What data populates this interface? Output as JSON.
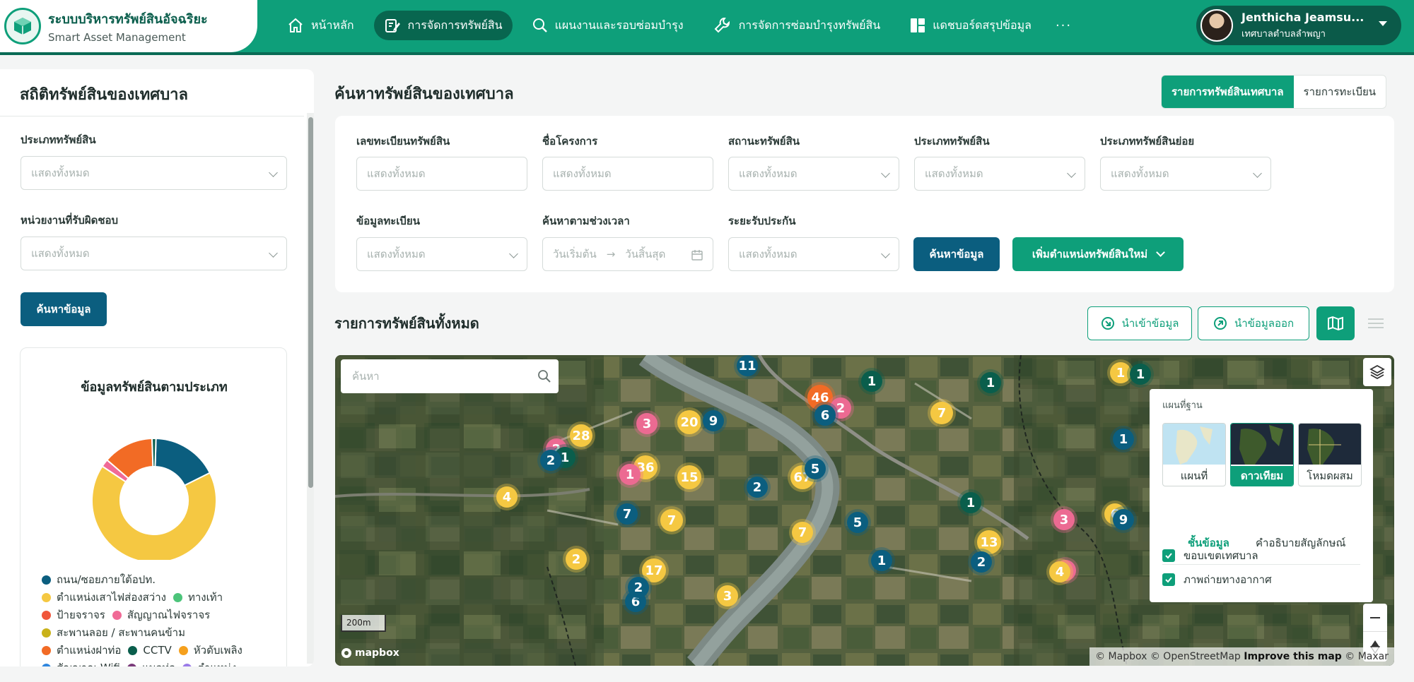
{
  "header": {
    "app_title": "ระบบบริหารทรัพย์สินอัจฉริยะ",
    "app_subtitle": "Smart Asset Management",
    "nav": [
      {
        "label": "หน้าหลัก"
      },
      {
        "label": "การจัดการทรัพย์สิน"
      },
      {
        "label": "แผนงานและรอบซ่อมบำรุง"
      },
      {
        "label": "การจัดการซ่อมบำรุงทรัพย์สิน"
      },
      {
        "label": "แดชบอร์ดสรุปข้อมูล"
      }
    ],
    "more": "···",
    "user_name": "Jenthicha Jeamsu...",
    "user_org": "เทศบาลตำบลลำพญา"
  },
  "sidebar": {
    "title": "สถิติทรัพย์สินของเทศบาล",
    "asset_type_label": "ประเภททรัพย์สิน",
    "asset_type_value": "แสดงทั้งหมด",
    "unit_label": "หน่วยงานที่รับผิดชอบ",
    "unit_value": "แสดงทั้งหมด",
    "search_button": "ค้นหาข้อมูล",
    "chart_title": "ข้อมูลทรัพย์สินตามประเภท",
    "legend": [
      {
        "label": "ถนน/ซอยภายใต้อปท.",
        "color": "#0b5e7f"
      },
      {
        "label": "ตำแหน่งเสาไฟส่องสว่าง",
        "color": "#f5c842"
      },
      {
        "label": "ทางเท้า",
        "color": "#4cc47a"
      },
      {
        "label": "ป้ายจราจร",
        "color": "#f0563b"
      },
      {
        "label": "สัญญาณไฟจราจร",
        "color": "#f06a96"
      },
      {
        "label": "สะพานลอย / สะพานคนข้าม",
        "color": "#c9b21a"
      },
      {
        "label": "ตำแหน่งฝาท่อ",
        "color": "#f26b25"
      },
      {
        "label": "CCTV",
        "color": "#0a5e4c"
      },
      {
        "label": "หัวดับเพลิง",
        "color": "#f5a01d"
      },
      {
        "label": "สัญญาณ Wifi",
        "color": "#2f86de"
      },
      {
        "label": "แนวท่อ",
        "color": "#7a3b7a"
      },
      {
        "label": "ตำแหน่ง",
        "color": "#9b7be8"
      }
    ]
  },
  "chart_data": {
    "type": "pie",
    "labels": [
      "ถนน/ซอยภายใต้อปท.",
      "ตำแหน่งเสาไฟส่องสว่าง",
      "สัญญาณไฟจราจร",
      "ตำแหน่งฝาท่อ",
      "CCTV"
    ],
    "values": [
      17,
      66,
      2,
      13,
      1
    ],
    "colors": [
      "#0b5e7f",
      "#f5c842",
      "#f06a96",
      "#f26b25",
      "#0a5e4c"
    ]
  },
  "main": {
    "title": "ค้นหาทรัพย์สินของเทศบาล",
    "tabs": [
      {
        "label": "รายการทรัพย์สินเทศบาล"
      },
      {
        "label": "รายการทะเบียน"
      }
    ],
    "filters": {
      "reg_no_label": "เลขทะเบียนทรัพย์สิน",
      "reg_no_placeholder": "แสดงทั้งหมด",
      "project_label": "ชื่อโครงการ",
      "project_placeholder": "แสดงทั้งหมด",
      "status_label": "สถานะทรัพย์สิน",
      "status_value": "แสดงทั้งหมด",
      "type_label": "ประเภททรัพย์สิน",
      "type_value": "แสดงทั้งหมด",
      "subtype_label": "ประเภททรัพย์สินย่อย",
      "subtype_value": "แสดงทั้งหมด",
      "reg_info_label": "ข้อมูลทะเบียน",
      "reg_info_value": "แสดงทั้งหมด",
      "period_label": "ค้นหาตามช่วงเวลา",
      "start_placeholder": "วันเริ่มต้น",
      "end_placeholder": "วันสิ้นสุด",
      "warranty_label": "ระยะรับประกัน",
      "warranty_value": "แสดงทั้งหมด",
      "search_button": "ค้นหาข้อมูล",
      "add_button": "เพิ่มตำแหน่งทรัพย์สินใหม่"
    },
    "list_title": "รายการทรัพย์สินทั้งหมด",
    "import_button": "นำเข้าข้อมูล",
    "export_button": "นำข้อมูลออก"
  },
  "map": {
    "search_placeholder": "ค้นหา",
    "basemap_title": "แผนที่ฐาน",
    "basemaps": [
      {
        "label": "แผนที่"
      },
      {
        "label": "ดาวเทียม"
      },
      {
        "label": "โหมดผสม"
      }
    ],
    "tab_layers": "ชั้นข้อมูล",
    "tab_legend": "คำอธิบายสัญลักษณ์",
    "layers": [
      {
        "label": "ขอบเขตเทศบาล"
      },
      {
        "label": "ภาพถ่ายทางอากาศ"
      }
    ],
    "scale": "200m",
    "mapbox": "mapbox",
    "attribution_a": "© Mapbox © OpenStreetMap",
    "attribution_b": "Improve this map",
    "attribution_c": "© Maxar",
    "clusters": [
      {
        "n": "11",
        "t": "navy"
      },
      {
        "n": "1",
        "t": "teal"
      },
      {
        "n": "1",
        "t": "teal"
      },
      {
        "n": "1",
        "t": "yellow"
      },
      {
        "n": "1",
        "t": "teal"
      },
      {
        "n": "46",
        "t": "orange"
      },
      {
        "n": "2",
        "t": "pink"
      },
      {
        "n": "6",
        "t": "navy"
      },
      {
        "n": "3",
        "t": "pink"
      },
      {
        "n": "20",
        "t": "yellow"
      },
      {
        "n": "9",
        "t": "navy"
      },
      {
        "n": "28",
        "t": "yellow"
      },
      {
        "n": "2",
        "t": "pink"
      },
      {
        "n": "1",
        "t": "teal"
      },
      {
        "n": "2",
        "t": "navy"
      },
      {
        "n": "7",
        "t": "yellow"
      },
      {
        "n": "1",
        "t": "navy"
      },
      {
        "n": "36",
        "t": "yellow"
      },
      {
        "n": "1",
        "t": "pink"
      },
      {
        "n": "15",
        "t": "yellow"
      },
      {
        "n": "2",
        "t": "navy"
      },
      {
        "n": "67",
        "t": "yellow"
      },
      {
        "n": "5",
        "t": "navy"
      },
      {
        "n": "4",
        "t": "yellow"
      },
      {
        "n": "7",
        "t": "navy"
      },
      {
        "n": "7",
        "t": "yellow"
      },
      {
        "n": "1",
        "t": "teal"
      },
      {
        "n": "6",
        "t": "yellow"
      },
      {
        "n": "9",
        "t": "navy"
      },
      {
        "n": "3",
        "t": "pink"
      },
      {
        "n": "5",
        "t": "navy"
      },
      {
        "n": "7",
        "t": "yellow"
      },
      {
        "n": "2",
        "t": "yellow"
      },
      {
        "n": "17",
        "t": "yellow"
      },
      {
        "n": "1",
        "t": "navy"
      },
      {
        "n": "3",
        "t": "pink"
      },
      {
        "n": "13",
        "t": "yellow"
      },
      {
        "n": "2",
        "t": "navy"
      },
      {
        "n": "4",
        "t": "yellow"
      },
      {
        "n": "2",
        "t": "navy"
      },
      {
        "n": "1",
        "t": "navy"
      },
      {
        "n": "3",
        "t": "yellow"
      },
      {
        "n": "6",
        "t": "navy"
      },
      {
        "n": "2",
        "t": "navy"
      }
    ]
  }
}
